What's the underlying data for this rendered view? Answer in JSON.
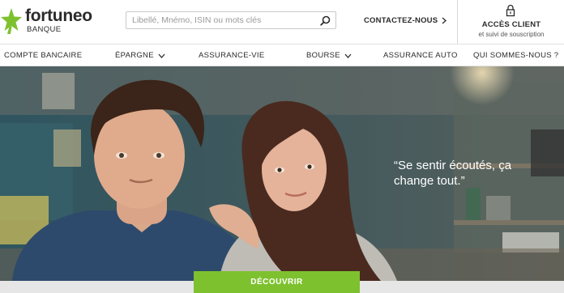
{
  "brand": {
    "name": "fortuneo",
    "sub": "BANQUE",
    "accent": "#7ec12f"
  },
  "search": {
    "placeholder": "Libellé, Mnémo, ISIN ou mots clés",
    "icon": "search-icon"
  },
  "header": {
    "contact_label": "CONTACTEZ-NOUS",
    "client_title": "ACCÈS CLIENT",
    "client_sub": "et suivi de souscription",
    "client_icon": "lock-icon"
  },
  "nav": {
    "items": [
      {
        "label": "COMPTE BANCAIRE"
      },
      {
        "label": "ÉPARGNE",
        "has_dropdown": true
      },
      {
        "label": "ASSURANCE-VIE"
      },
      {
        "label": "BOURSE",
        "has_dropdown": true
      },
      {
        "label": "ASSURANCE AUTO"
      },
      {
        "label": "QUI SOMMES-NOUS ?"
      }
    ]
  },
  "hero": {
    "quote": "“Se sentir écoutés, ça change tout.”",
    "cta_label": "DÉCOUVRIR"
  }
}
